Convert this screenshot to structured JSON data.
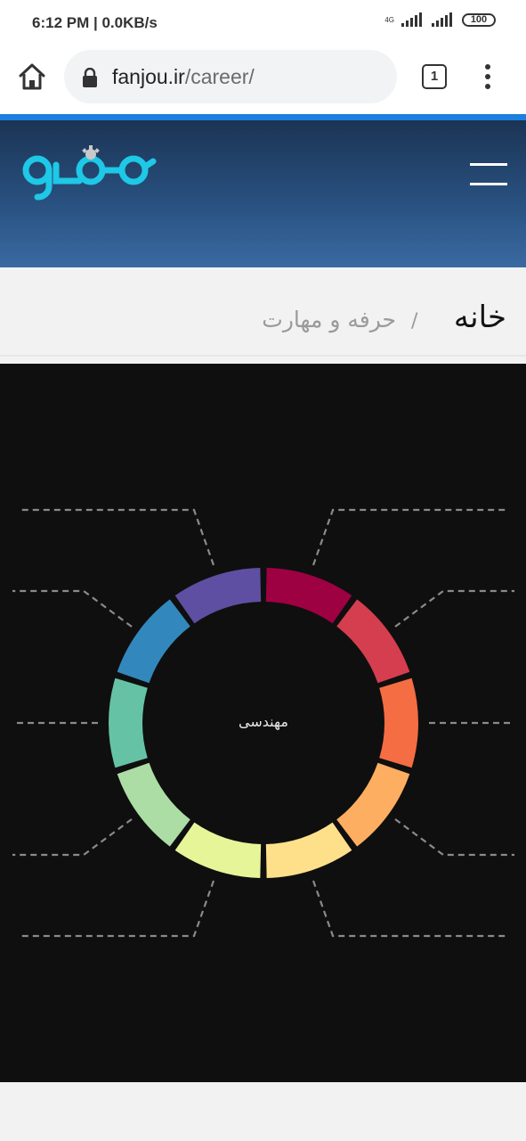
{
  "status_bar": {
    "time": "6:12 PM | 0.0KB/s",
    "network": "4G",
    "battery": "100",
    "icons": [
      "signal-icon",
      "signal-icon",
      "battery-icon"
    ]
  },
  "browser": {
    "url_host": "fanjou.ir",
    "url_path": "/career/",
    "tab_count": "1",
    "icons": [
      "home-icon",
      "lock-icon",
      "tabs-icon",
      "more-vert-icon"
    ]
  },
  "site": {
    "logo_alt": "fanjou-logo",
    "accent_color": "#1a7fde",
    "logo_color": "#1ec8e6",
    "menu_icon": "hamburger-icon"
  },
  "breadcrumb": {
    "home": "خانه",
    "separator": "/",
    "current": "حرفه و مهارت"
  },
  "wheel": {
    "center_label": "مهندسی",
    "segment_colors": [
      "#9e0142",
      "#d53e4f",
      "#f46d43",
      "#fdae61",
      "#fee08b",
      "#e6f598",
      "#abdda4",
      "#66c2a5",
      "#3288bd",
      "#5e4fa2"
    ],
    "segment_labels": [
      "",
      "",
      "",
      "",
      "",
      "",
      "",
      "",
      "",
      ""
    ]
  }
}
